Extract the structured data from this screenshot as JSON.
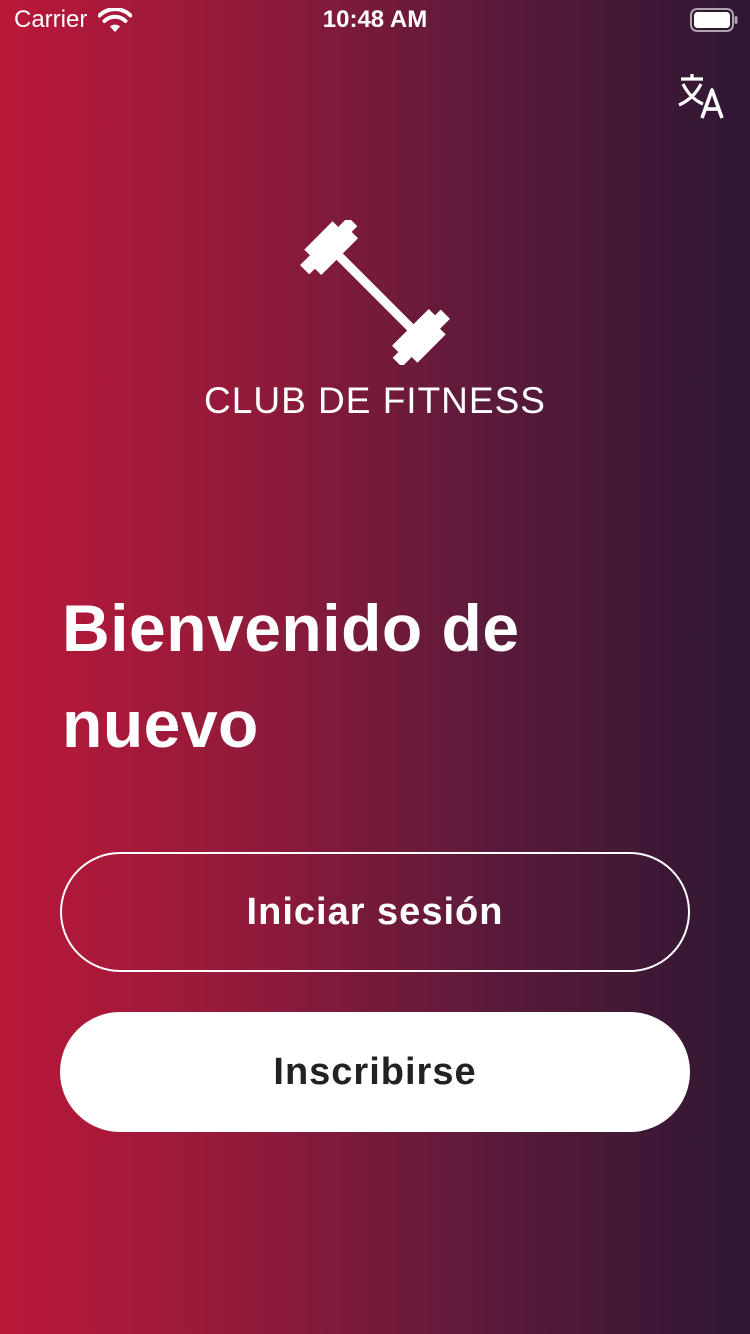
{
  "status_bar": {
    "carrier": "Carrier",
    "time": "10:48 AM",
    "icons": [
      "wifi-icon",
      "battery-icon"
    ]
  },
  "header": {
    "language_icon": "translate-icon"
  },
  "logo": {
    "icon": "barbell-icon",
    "brand_name": "CLUB DE FITNESS"
  },
  "welcome": {
    "title": "Bienvenido de nuevo"
  },
  "actions": {
    "login_label": "Iniciar sesión",
    "signup_label": "Inscribirse"
  },
  "colors": {
    "gradient_start": "#bb1839",
    "gradient_end": "#2d1733",
    "text": "#ffffff",
    "signup_button_bg": "#ffffff",
    "signup_button_text": "#222222"
  }
}
